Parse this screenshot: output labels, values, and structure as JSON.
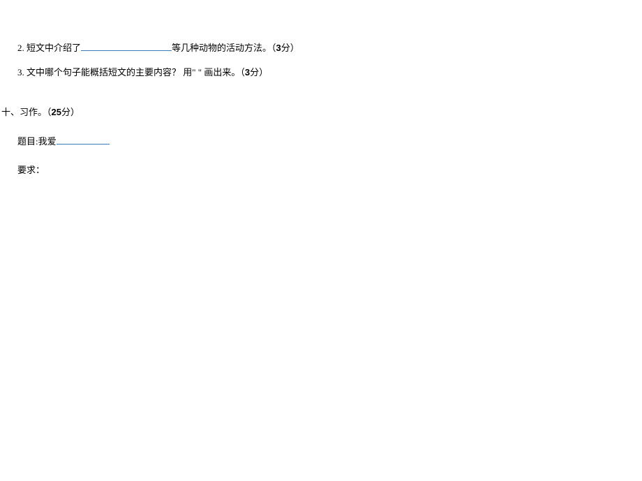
{
  "q2": {
    "prefix": "2. 短文中介绍了",
    "suffix": "等几种动物的活动方法。（",
    "points": "3",
    "end": "分）"
  },
  "q3": {
    "text": "3. 文中哪个句子能概括短文的主要内容？ 用\" \" 画出来。（",
    "points": "3",
    "end": "分）"
  },
  "section_ten": {
    "label": "十、习作。（",
    "points": "25",
    "end": "分）"
  },
  "essay": {
    "title_prefix": "题目:我爱"
  },
  "requirement": {
    "label": "要求："
  }
}
